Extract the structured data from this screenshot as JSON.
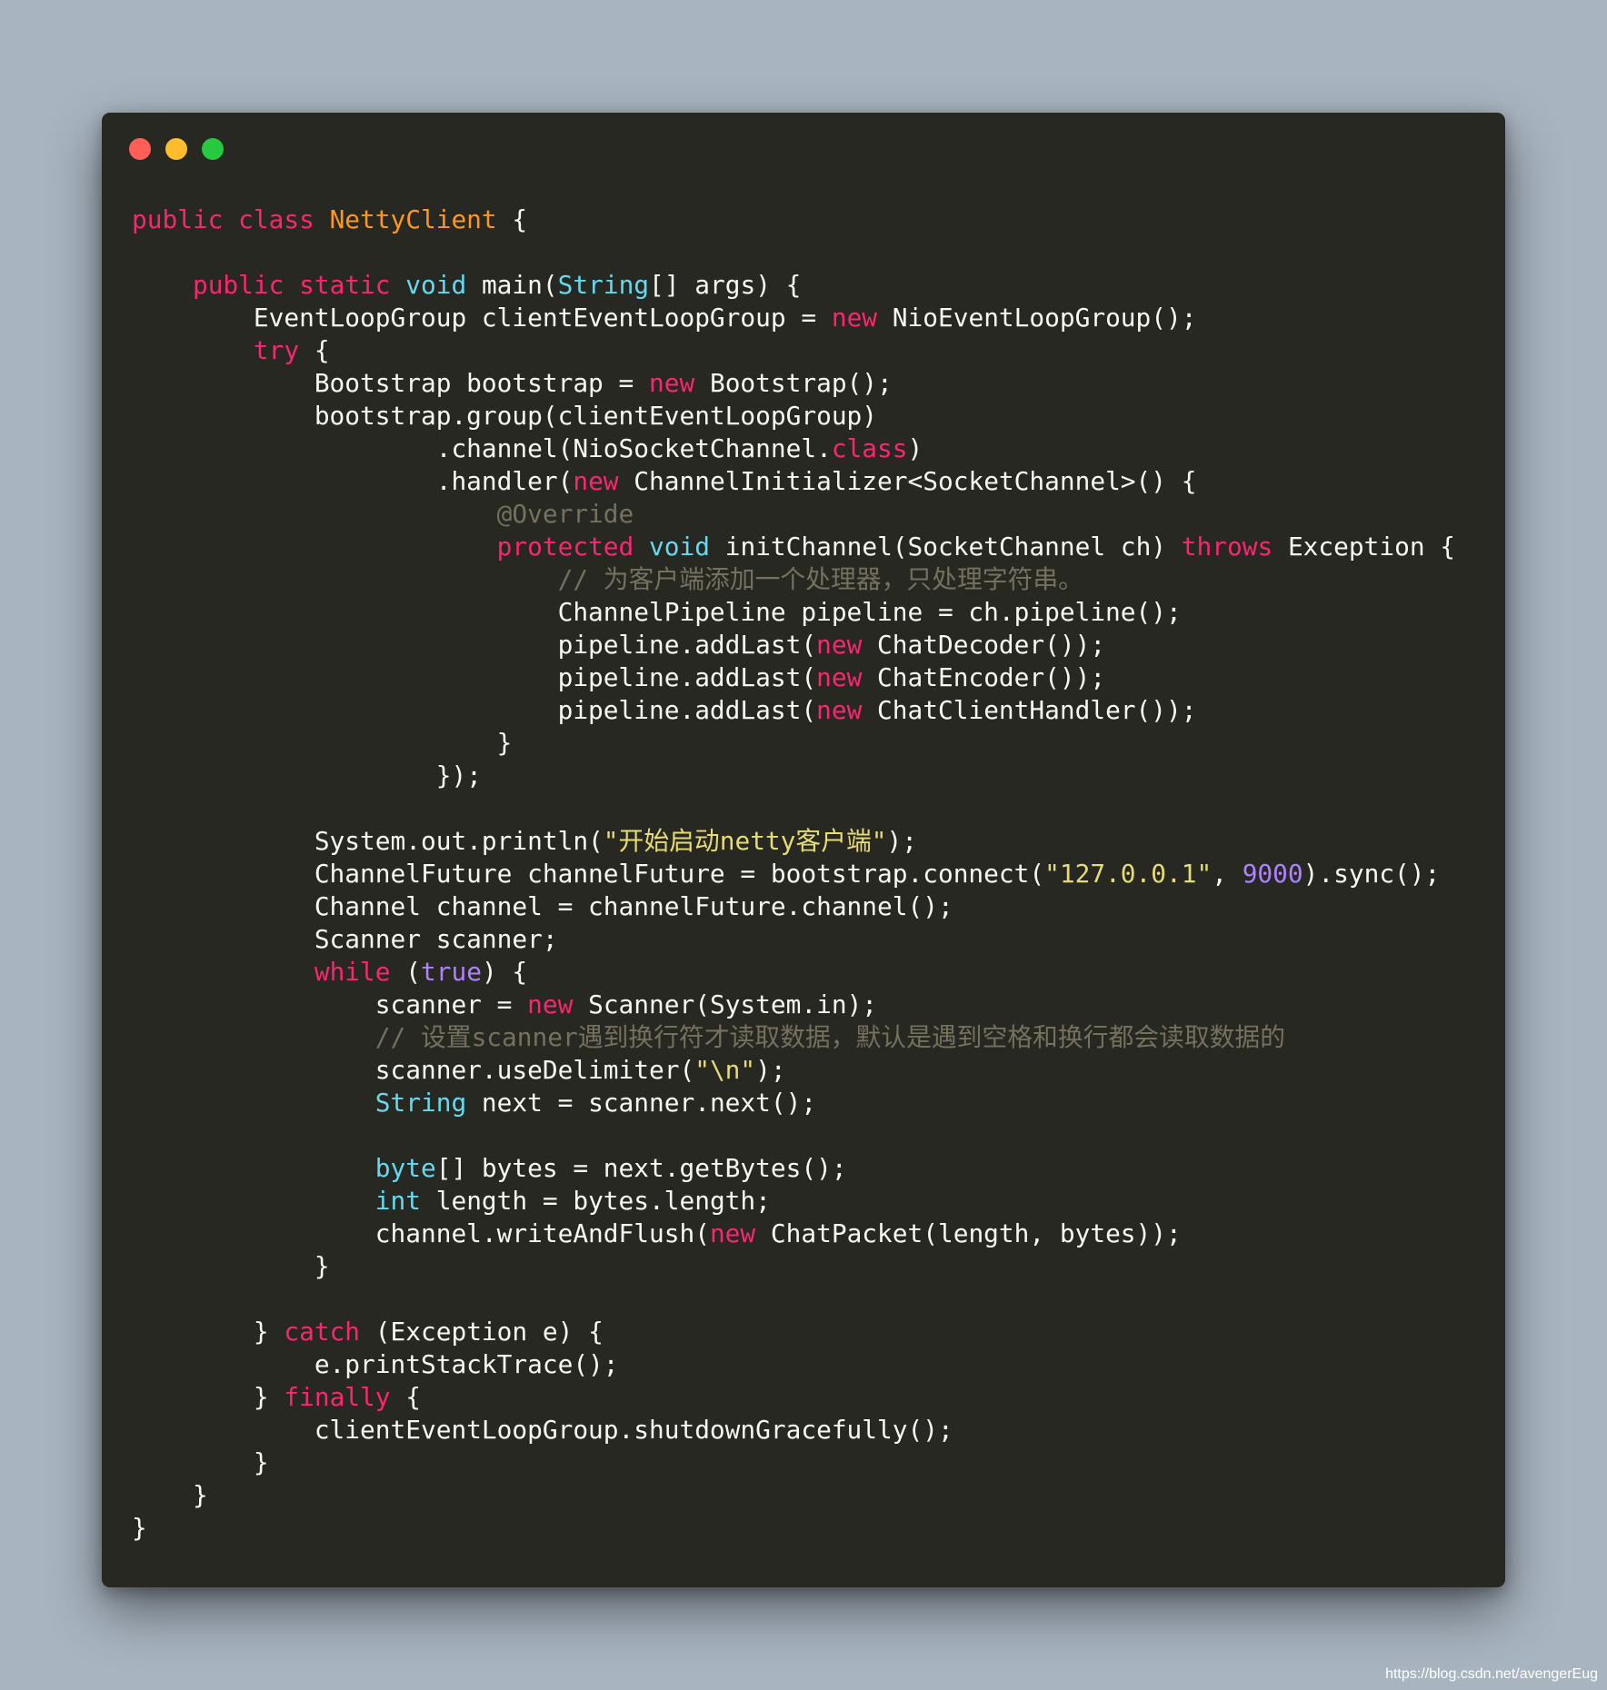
{
  "window": {
    "traffic_lights": [
      {
        "name": "close",
        "color": "#ff5f56"
      },
      {
        "name": "minimize",
        "color": "#ffbd2e"
      },
      {
        "name": "maximize",
        "color": "#27c93f"
      }
    ]
  },
  "theme": {
    "background": "#272822",
    "plain": "#f8f8f2",
    "keyword": "#f92672",
    "type": "#66d9ef",
    "class_name": "#fd971f",
    "string": "#e6db74",
    "number": "#ae81ff",
    "comment": "#75715e"
  },
  "code": {
    "language": "java",
    "lines": [
      [
        [
          "kw",
          "public class "
        ],
        [
          "cls",
          "NettyClient"
        ],
        [
          "plain",
          " {"
        ]
      ],
      [],
      [
        [
          "plain",
          "    "
        ],
        [
          "kw",
          "public static "
        ],
        [
          "type",
          "void"
        ],
        [
          "plain",
          " main("
        ],
        [
          "type",
          "String"
        ],
        [
          "plain",
          "[] args) {"
        ]
      ],
      [
        [
          "plain",
          "        EventLoopGroup clientEventLoopGroup = "
        ],
        [
          "kw",
          "new"
        ],
        [
          "plain",
          " NioEventLoopGroup();"
        ]
      ],
      [
        [
          "plain",
          "        "
        ],
        [
          "kw",
          "try"
        ],
        [
          "plain",
          " {"
        ]
      ],
      [
        [
          "plain",
          "            Bootstrap bootstrap = "
        ],
        [
          "kw",
          "new"
        ],
        [
          "plain",
          " Bootstrap();"
        ]
      ],
      [
        [
          "plain",
          "            bootstrap.group(clientEventLoopGroup)"
        ]
      ],
      [
        [
          "plain",
          "                    .channel(NioSocketChannel."
        ],
        [
          "kw",
          "class"
        ],
        [
          "plain",
          ")"
        ]
      ],
      [
        [
          "plain",
          "                    .handler("
        ],
        [
          "kw",
          "new"
        ],
        [
          "plain",
          " ChannelInitializer<SocketChannel>() {"
        ]
      ],
      [
        [
          "plain",
          "                        "
        ],
        [
          "com",
          "@Override"
        ]
      ],
      [
        [
          "plain",
          "                        "
        ],
        [
          "kw",
          "protected"
        ],
        [
          "plain",
          " "
        ],
        [
          "type",
          "void"
        ],
        [
          "plain",
          " initChannel(SocketChannel ch) "
        ],
        [
          "kw",
          "throws"
        ],
        [
          "plain",
          " Exception {"
        ]
      ],
      [
        [
          "plain",
          "                            "
        ],
        [
          "com",
          "// 为客户端添加一个处理器，只处理字符串。"
        ]
      ],
      [
        [
          "plain",
          "                            ChannelPipeline pipeline = ch.pipeline();"
        ]
      ],
      [
        [
          "plain",
          "                            pipeline.addLast("
        ],
        [
          "kw",
          "new"
        ],
        [
          "plain",
          " ChatDecoder());"
        ]
      ],
      [
        [
          "plain",
          "                            pipeline.addLast("
        ],
        [
          "kw",
          "new"
        ],
        [
          "plain",
          " ChatEncoder());"
        ]
      ],
      [
        [
          "plain",
          "                            pipeline.addLast("
        ],
        [
          "kw",
          "new"
        ],
        [
          "plain",
          " ChatClientHandler());"
        ]
      ],
      [
        [
          "plain",
          "                        }"
        ]
      ],
      [
        [
          "plain",
          "                    });"
        ]
      ],
      [],
      [
        [
          "plain",
          "            System.out.println("
        ],
        [
          "str",
          "\"开始启动netty客户端\""
        ],
        [
          "plain",
          ");"
        ]
      ],
      [
        [
          "plain",
          "            ChannelFuture channelFuture = bootstrap.connect("
        ],
        [
          "str",
          "\"127.0.0.1\""
        ],
        [
          "plain",
          ", "
        ],
        [
          "num",
          "9000"
        ],
        [
          "plain",
          ").sync();"
        ]
      ],
      [
        [
          "plain",
          "            Channel channel = channelFuture.channel();"
        ]
      ],
      [
        [
          "plain",
          "            Scanner scanner;"
        ]
      ],
      [
        [
          "plain",
          "            "
        ],
        [
          "kw",
          "while"
        ],
        [
          "plain",
          " ("
        ],
        [
          "num",
          "true"
        ],
        [
          "plain",
          ") {"
        ]
      ],
      [
        [
          "plain",
          "                scanner = "
        ],
        [
          "kw",
          "new"
        ],
        [
          "plain",
          " Scanner(System.in);"
        ]
      ],
      [
        [
          "plain",
          "                "
        ],
        [
          "com",
          "// 设置scanner遇到换行符才读取数据，默认是遇到空格和换行都会读取数据的"
        ]
      ],
      [
        [
          "plain",
          "                scanner.useDelimiter("
        ],
        [
          "str",
          "\"\\n\""
        ],
        [
          "plain",
          ");"
        ]
      ],
      [
        [
          "plain",
          "                "
        ],
        [
          "type",
          "String"
        ],
        [
          "plain",
          " next = scanner.next();"
        ]
      ],
      [],
      [
        [
          "plain",
          "                "
        ],
        [
          "type",
          "byte"
        ],
        [
          "plain",
          "[] bytes = next.getBytes();"
        ]
      ],
      [
        [
          "plain",
          "                "
        ],
        [
          "type",
          "int"
        ],
        [
          "plain",
          " length = bytes.length;"
        ]
      ],
      [
        [
          "plain",
          "                channel.writeAndFlush("
        ],
        [
          "kw",
          "new"
        ],
        [
          "plain",
          " ChatPacket(length, bytes));"
        ]
      ],
      [
        [
          "plain",
          "            }"
        ]
      ],
      [],
      [
        [
          "plain",
          "        } "
        ],
        [
          "kw",
          "catch"
        ],
        [
          "plain",
          " (Exception e) {"
        ]
      ],
      [
        [
          "plain",
          "            e.printStackTrace();"
        ]
      ],
      [
        [
          "plain",
          "        } "
        ],
        [
          "kw",
          "finally"
        ],
        [
          "plain",
          " {"
        ]
      ],
      [
        [
          "plain",
          "            clientEventLoopGroup.shutdownGracefully();"
        ]
      ],
      [
        [
          "plain",
          "        }"
        ]
      ],
      [
        [
          "plain",
          "    }"
        ]
      ],
      [
        [
          "plain",
          "}"
        ]
      ]
    ]
  },
  "watermark": "https://blog.csdn.net/avengerEug"
}
